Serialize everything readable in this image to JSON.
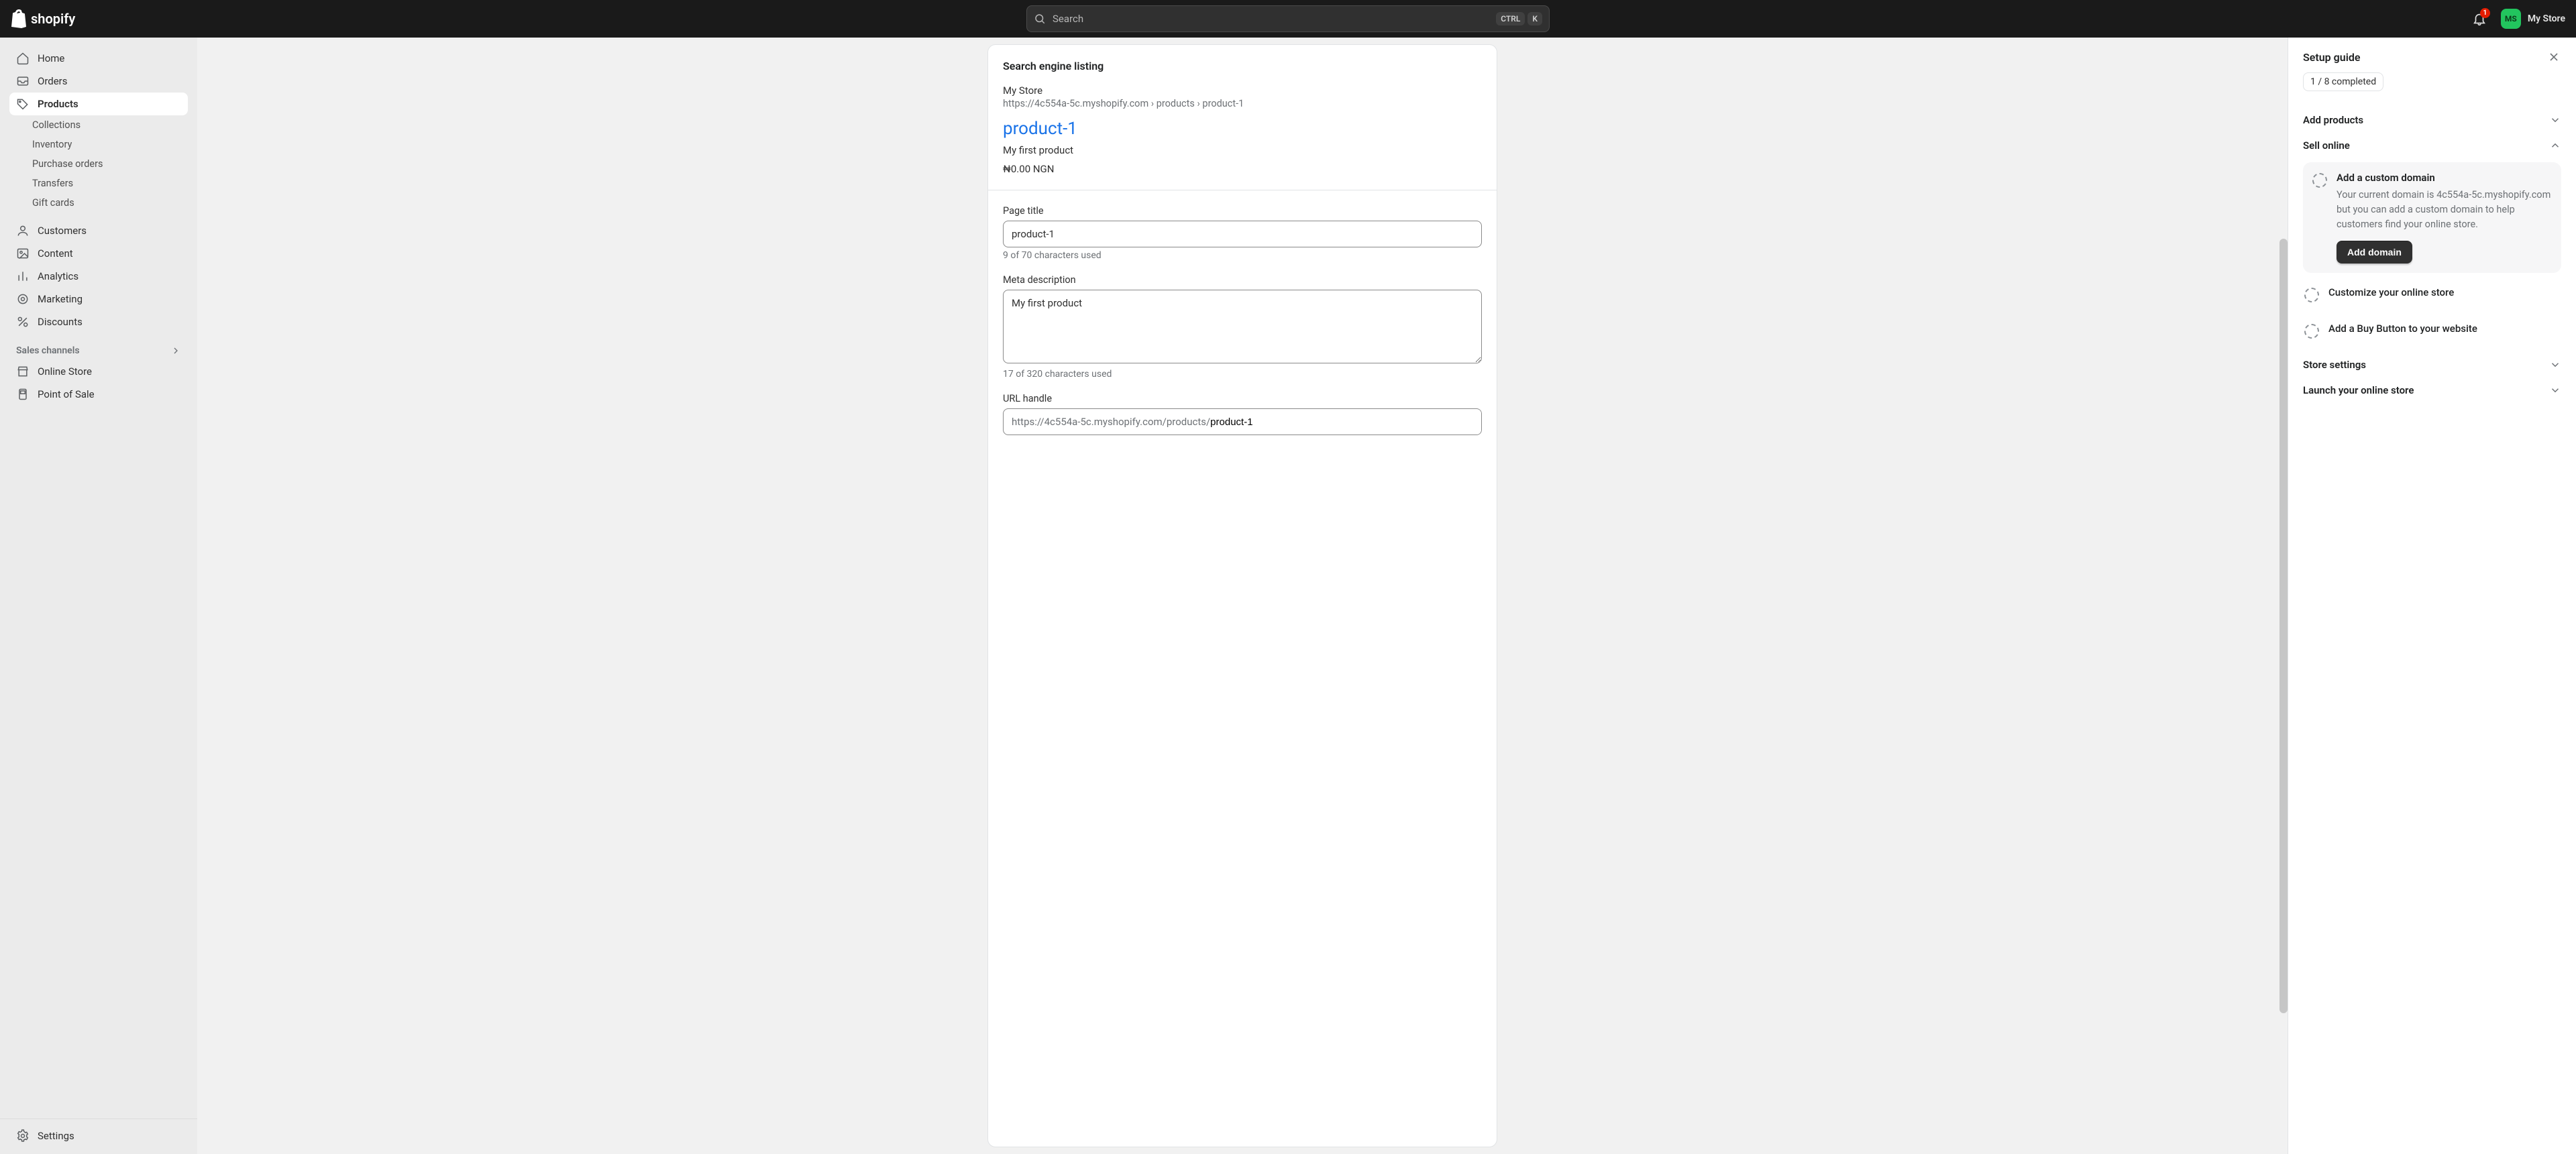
{
  "topbar": {
    "brand": "shopify",
    "search_placeholder": "Search",
    "kbd_ctrl": "CTRL",
    "kbd_k": "K",
    "notif_count": "1",
    "avatar_initials": "MS",
    "store_name": "My Store"
  },
  "nav": {
    "home": "Home",
    "orders": "Orders",
    "products": "Products",
    "products_children": {
      "collections": "Collections",
      "inventory": "Inventory",
      "purchase_orders": "Purchase orders",
      "transfers": "Transfers",
      "gift_cards": "Gift cards"
    },
    "customers": "Customers",
    "content": "Content",
    "analytics": "Analytics",
    "marketing": "Marketing",
    "discounts": "Discounts",
    "sales_channels_header": "Sales channels",
    "online_store": "Online Store",
    "point_of_sale": "Point of Sale",
    "settings": "Settings"
  },
  "main": {
    "section_title": "Search engine listing",
    "store_name": "My Store",
    "url_preview": "https://4c554a-5c.myshopify.com › products › product-1",
    "product_link": "product-1",
    "description_preview": "My first product",
    "price_preview": "₦0.00 NGN",
    "page_title_label": "Page title",
    "page_title_value": "product-1",
    "page_title_helper": "9 of 70 characters used",
    "meta_label": "Meta description",
    "meta_value": "My first product",
    "meta_helper": "17 of 320 characters used",
    "handle_label": "URL handle",
    "handle_prefix": "https://4c554a-5c.myshopify.com/products/",
    "handle_value": "product-1"
  },
  "setup": {
    "title": "Setup guide",
    "progress": "1 / 8 completed",
    "add_products": "Add products",
    "sell_online": "Sell online",
    "task_domain_title": "Add a custom domain",
    "task_domain_desc": "Your current domain is 4c554a-5c.myshopify.com but you can add a custom domain to help customers find your online store.",
    "task_domain_btn": "Add domain",
    "task_customize": "Customize your online store",
    "task_buy_button": "Add a Buy Button to your website",
    "store_settings": "Store settings",
    "launch": "Launch your online store"
  }
}
